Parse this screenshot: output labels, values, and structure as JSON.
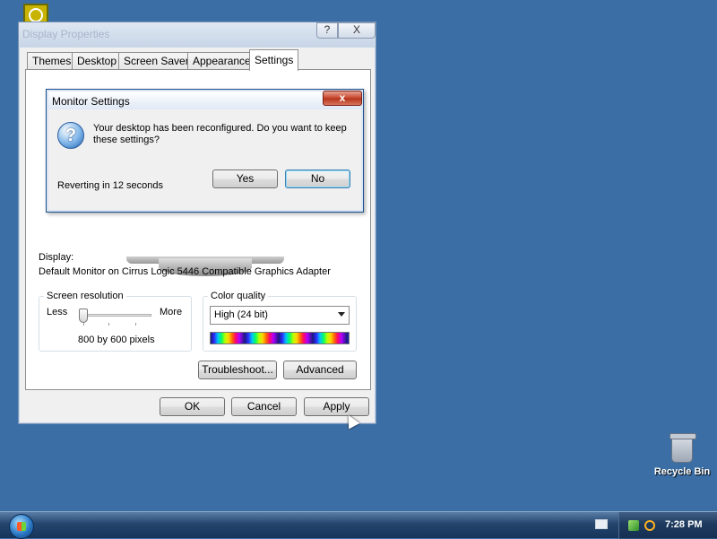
{
  "desktop": {
    "recycle_bin_label": "Recycle Bin",
    "background_color": "#3a6ea5"
  },
  "main_dialog": {
    "title": "Display Properties",
    "help_label": "?",
    "close_label": "X",
    "tabs": [
      {
        "label": "Themes"
      },
      {
        "label": "Desktop"
      },
      {
        "label": "Screen Saver"
      },
      {
        "label": "Appearance"
      },
      {
        "label": "Settings",
        "active": true
      }
    ],
    "display_label": "Display:",
    "display_value": "Default Monitor on Cirrus Logic 5446 Compatible Graphics Adapter",
    "screen_resolution": {
      "legend": "Screen resolution",
      "less_label": "Less",
      "more_label": "More",
      "value": "800 by 600 pixels"
    },
    "color_quality": {
      "legend": "Color quality",
      "selected": "High (24 bit)"
    },
    "troubleshoot_label": "Troubleshoot...",
    "advanced_label": "Advanced",
    "ok_label": "OK",
    "cancel_label": "Cancel",
    "apply_label": "Apply"
  },
  "monitor_dialog": {
    "title": "Monitor Settings",
    "close_label": "x",
    "icon_symbol": "?",
    "message": "Your desktop has been reconfigured.  Do you want to keep these settings?",
    "countdown": "Reverting in 12 seconds",
    "yes_label": "Yes",
    "no_label": "No"
  },
  "taskbar": {
    "clock": "7:28 PM"
  }
}
